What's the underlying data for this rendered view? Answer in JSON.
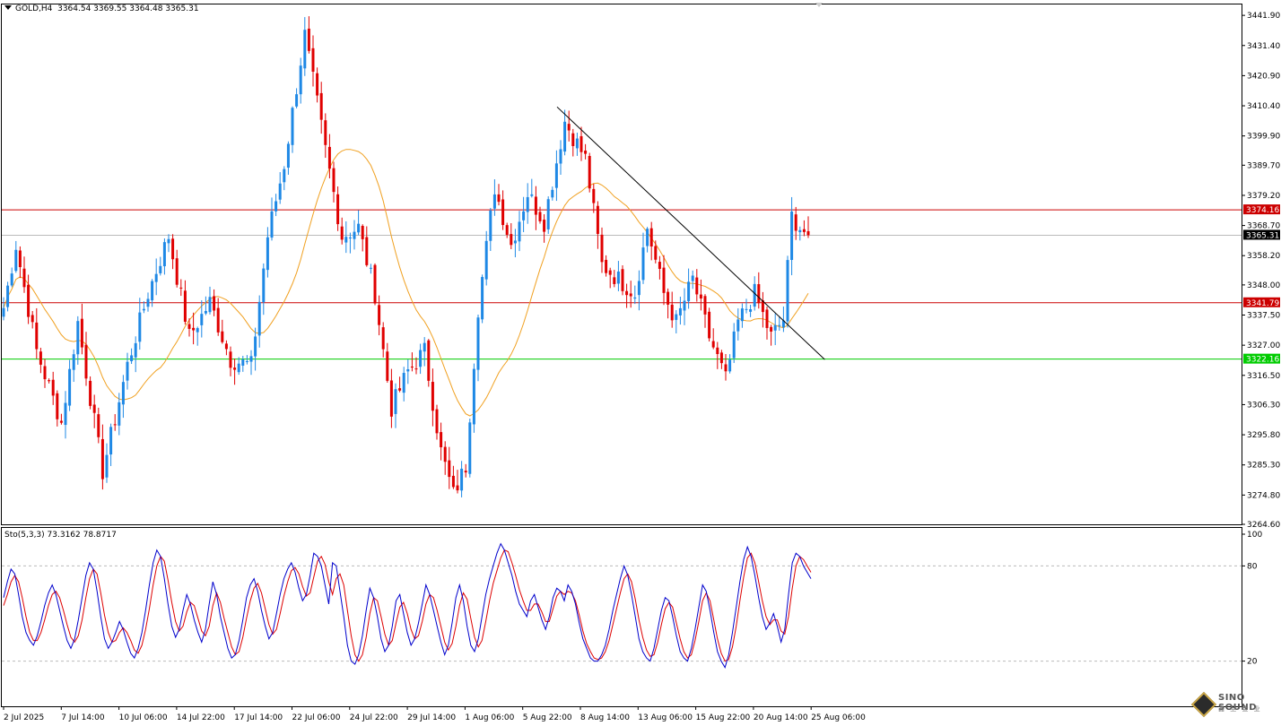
{
  "header": {
    "symbol": "GOLD,H4",
    "ohlc": "3364.54 3369.55 3364.48 3365.31"
  },
  "stochastic": {
    "label": "Sto(5,3,3) 73.3162 78.8717",
    "levels": [
      20,
      80
    ],
    "ticks": [
      "100",
      "80",
      "20"
    ],
    "main_color": "#0000cc",
    "signal_color": "#dd0000"
  },
  "logo": {
    "word1": "SINO SOUND",
    "word2": "鑫 圣 金 业"
  },
  "chart_data": {
    "type": "candlestick",
    "symbol": "GOLD",
    "timeframe": "H4",
    "ylim": [
      3264.6,
      3446.0
    ],
    "y_ticks": [
      "3441.90",
      "3431.40",
      "3420.90",
      "3410.40",
      "3399.90",
      "3389.70",
      "3379.20",
      "3368.70",
      "3358.20",
      "3348.00",
      "3337.50",
      "3327.00",
      "3316.50",
      "3306.30",
      "3295.80",
      "3285.30",
      "3274.80",
      "3264.60"
    ],
    "x_ticks": [
      "2 Jul 2025",
      "7 Jul 14:00",
      "10 Jul 06:00",
      "14 Jul 22:00",
      "17 Jul 14:00",
      "22 Jul 06:00",
      "24 Jul 22:00",
      "29 Jul 14:00",
      "1 Aug 06:00",
      "5 Aug 22:00",
      "8 Aug 14:00",
      "13 Aug 06:00",
      "15 Aug 22:00",
      "20 Aug 14:00",
      "25 Aug 06:00"
    ],
    "bull_color": "#1e88e5",
    "bear_color": "#e00000",
    "ma_color": "#f0a020",
    "horizontal_lines": [
      {
        "price": 3374.16,
        "label": "3374.16",
        "color": "#cc0000"
      },
      {
        "price": 3365.31,
        "label": "3365.31",
        "color": "#bbbbbb",
        "label_bg": "#000000"
      },
      {
        "price": 3341.79,
        "label": "3341.79",
        "color": "#cc0000"
      },
      {
        "price": 3322.16,
        "label": "3322.16",
        "color": "#00cc00"
      }
    ],
    "trendline": {
      "from": [
        100,
        3410.0
      ],
      "to": [
        149,
        3322.0
      ]
    },
    "stochastic_main": [
      60,
      70,
      78,
      75,
      62,
      48,
      38,
      33,
      30,
      36,
      45,
      55,
      63,
      68,
      62,
      52,
      42,
      33,
      28,
      34,
      46,
      60,
      74,
      82,
      78,
      64,
      48,
      34,
      28,
      32,
      38,
      45,
      40,
      32,
      25,
      22,
      28,
      38,
      52,
      68,
      82,
      90,
      86,
      72,
      56,
      42,
      35,
      40,
      52,
      62,
      56,
      46,
      38,
      32,
      40,
      56,
      70,
      62,
      48,
      38,
      28,
      22,
      24,
      33,
      46,
      60,
      68,
      72,
      64,
      52,
      42,
      34,
      38,
      50,
      62,
      72,
      78,
      82,
      76,
      66,
      58,
      62,
      74,
      88,
      86,
      80,
      68,
      56,
      82,
      80,
      64,
      48,
      30,
      20,
      18,
      24,
      36,
      52,
      66,
      60,
      48,
      34,
      26,
      30,
      42,
      58,
      62,
      50,
      38,
      30,
      34,
      44,
      56,
      68,
      62,
      52,
      42,
      32,
      24,
      30,
      44,
      60,
      68,
      58,
      42,
      30,
      26,
      34,
      48,
      62,
      72,
      80,
      88,
      94,
      90,
      82,
      74,
      64,
      56,
      52,
      48,
      58,
      62,
      54,
      46,
      40,
      48,
      60,
      66,
      64,
      58,
      68,
      64,
      56,
      44,
      34,
      28,
      22,
      20,
      20,
      24,
      30,
      40,
      52,
      62,
      72,
      80,
      74,
      62,
      48,
      34,
      26,
      22,
      20,
      28,
      40,
      52,
      60,
      58,
      48,
      36,
      26,
      22,
      20,
      28,
      40,
      54,
      68,
      64,
      52,
      38,
      26,
      20,
      16,
      24,
      38,
      54,
      70,
      84,
      92,
      86,
      74,
      60,
      48,
      40,
      44,
      50,
      42,
      32,
      40,
      62,
      82,
      88,
      86,
      80,
      76,
      72
    ],
    "stochastic_signal": [
      55,
      62,
      70,
      74,
      70,
      60,
      48,
      38,
      33,
      33,
      38,
      46,
      55,
      62,
      64,
      60,
      52,
      43,
      35,
      32,
      36,
      46,
      60,
      72,
      78,
      75,
      63,
      49,
      38,
      32,
      33,
      38,
      41,
      38,
      33,
      27,
      25,
      30,
      40,
      53,
      68,
      80,
      86,
      83,
      71,
      57,
      45,
      39,
      42,
      51,
      57,
      55,
      47,
      39,
      36,
      42,
      55,
      63,
      57,
      47,
      38,
      29,
      24,
      26,
      35,
      47,
      58,
      66,
      69,
      63,
      53,
      43,
      37,
      40,
      50,
      61,
      70,
      77,
      79,
      75,
      67,
      61,
      63,
      73,
      83,
      86,
      81,
      70,
      62,
      72,
      75,
      68,
      52,
      36,
      24,
      20,
      24,
      35,
      50,
      60,
      58,
      48,
      37,
      30,
      33,
      44,
      54,
      57,
      50,
      40,
      34,
      36,
      45,
      56,
      62,
      60,
      52,
      42,
      32,
      27,
      31,
      42,
      55,
      63,
      59,
      47,
      35,
      29,
      33,
      45,
      58,
      69,
      77,
      85,
      90,
      89,
      82,
      74,
      65,
      58,
      52,
      52,
      56,
      56,
      51,
      45,
      45,
      53,
      61,
      64,
      62,
      64,
      63,
      58,
      49,
      39,
      31,
      26,
      22,
      21,
      22,
      26,
      33,
      43,
      53,
      63,
      72,
      75,
      70,
      59,
      46,
      35,
      27,
      23,
      24,
      32,
      43,
      53,
      57,
      54,
      44,
      34,
      26,
      22,
      24,
      33,
      45,
      58,
      63,
      58,
      46,
      34,
      25,
      20,
      21,
      29,
      42,
      58,
      73,
      85,
      88,
      82,
      70,
      58,
      48,
      43,
      46,
      46,
      39,
      37,
      48,
      66,
      80,
      86,
      84,
      80,
      76
    ]
  }
}
